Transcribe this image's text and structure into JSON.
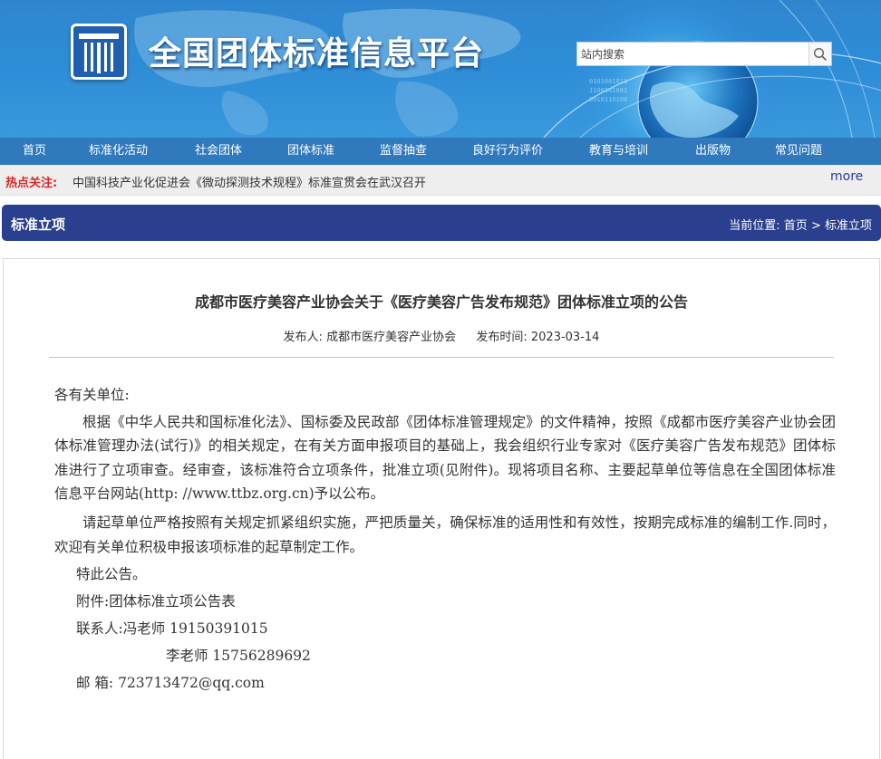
{
  "site": {
    "title": "全国团体标准信息平台",
    "search_placeholder": "站内搜索"
  },
  "nav": [
    "首页",
    "标准化活动",
    "社会团体",
    "团体标准",
    "监督抽查",
    "良好行为评价",
    "教育与培训",
    "出版物",
    "常见问题"
  ],
  "hot": {
    "label": "热点关注:",
    "text": "中国科技产业化促进会《微动探测技术规程》标准宣贯会在武汉召开",
    "more": "more"
  },
  "section": {
    "title": "标准立项",
    "breadcrumb_prefix": "当前位置:",
    "breadcrumb_home": "首页",
    "breadcrumb_sep": ">",
    "breadcrumb_current": "标准立项"
  },
  "article": {
    "title": "成都市医疗美容产业协会关于《医疗美容广告发布规范》团体标准立项的公告",
    "publisher_label": "发布人:",
    "publisher": "成都市医疗美容产业协会",
    "date_label": "发布时间:",
    "date": "2023-03-14",
    "salutation": "各有关单位:",
    "para1": "根据《中华人民共和国标准化法》、国标委及民政部《团体标准管理规定》的文件精神，按照《成都市医疗美容产业协会团体标准管理办法(试行)》的相关规定，在有关方面申报项目的基础上，我会组织行业专家对《医疗美容广告发布规范》团体标准进行了立项审查。经审查，该标准符合立项条件，批准立项(见附件)。现将项目名称、主要起草单位等信息在全国团体标准信息平台网站(http: //www.ttbz.org.cn)予以公布。",
    "para2": "请起草单位严格按照有关规定抓紧组织实施，严把质量关，确保标准的适用性和有效性，按期完成标准的编制工作.同时，欢迎有关单位积极申报该项标准的起草制定工作。",
    "para3": "特此公告。",
    "attachment": "附件:团体标准立项公告表",
    "contact1": "联系人:冯老师 19150391015",
    "contact2": "李老师 15756289692",
    "email": "邮 箱: 723713472@qq.com"
  },
  "colors": {
    "banner_blue": "#2e8cd6",
    "nav_blue": "#2f79bc",
    "section_bar": "#2a3f8e",
    "hot_label_red": "#d22a2a",
    "more_link": "#2a3aa8"
  }
}
